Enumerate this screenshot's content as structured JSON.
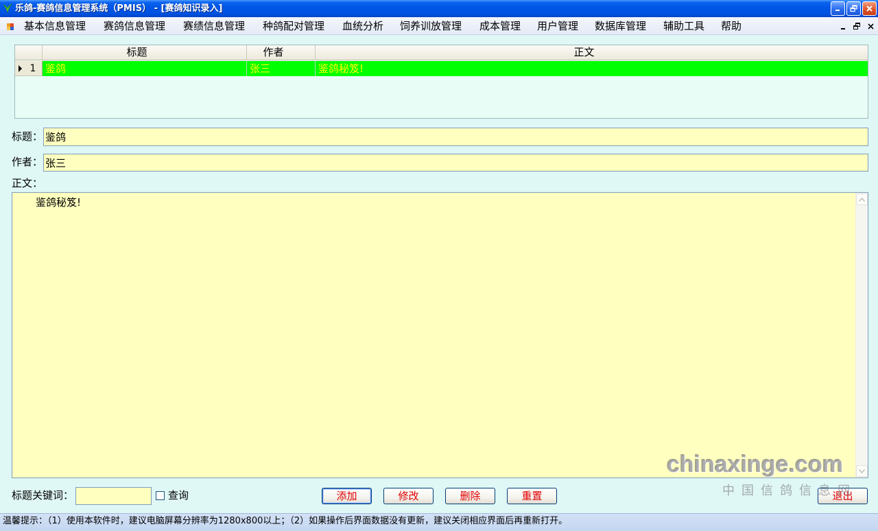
{
  "window": {
    "title": "乐鸽-赛鸽信息管理系统（PMIS） - [赛鸽知识录入]",
    "app_icon": "pigeon-app-icon",
    "controls": {
      "minimize": "minimize-icon",
      "restore": "restore-icon",
      "close": "close-icon"
    }
  },
  "menu": {
    "doc_icon": "form-icon",
    "items": [
      {
        "label": "基本信息管理"
      },
      {
        "label": "赛鸽信息管理"
      },
      {
        "label": "赛绩信息管理"
      },
      {
        "label": "种鸽配对管理"
      },
      {
        "label": "血统分析"
      },
      {
        "label": "饲养训放管理"
      },
      {
        "label": "成本管理"
      },
      {
        "label": "用户管理"
      },
      {
        "label": "数据库管理"
      },
      {
        "label": "辅助工具"
      },
      {
        "label": "帮助"
      }
    ],
    "mdi_controls": {
      "minimize": "mdi-minimize-icon",
      "restore": "mdi-restore-icon",
      "close": "mdi-close-icon"
    }
  },
  "grid": {
    "columns": [
      "标题",
      "作者",
      "正文"
    ],
    "current_row_icon": "current-row-arrow-icon",
    "rows": [
      {
        "index": "1",
        "title": "鉴鸽",
        "author": "张三",
        "body": "鉴鸽秘笈!"
      }
    ],
    "row_bg": "#00ff00",
    "row_fg": "#ffff00"
  },
  "form": {
    "title_label": "标题：",
    "title_value": "鉴鸽",
    "author_label": "作者：",
    "author_value": "张三",
    "body_label": "正文：",
    "body_value": "鉴鸽秘笈!",
    "field_bg": "#ffffc0"
  },
  "search": {
    "keyword_label": "标题关键词：",
    "keyword_value": "",
    "query_label": "查询",
    "query_checked": false
  },
  "buttons": {
    "add": "添加",
    "edit": "修改",
    "delete": "删除",
    "reset": "重置",
    "exit": "退出",
    "text_color": "#e00000"
  },
  "scrollbar_icons": {
    "up": "scroll-up-icon",
    "down": "scroll-down-icon"
  },
  "watermark": {
    "site": "chinaxinge.com",
    "name": "中国信鸽信息网"
  },
  "status": {
    "text": "温馨提示：（1）使用本软件时，建议电脑屏幕分辨率为1280x800以上；（2）如果操作后界面数据没有更新，建议关闭相应界面后再重新打开。"
  }
}
